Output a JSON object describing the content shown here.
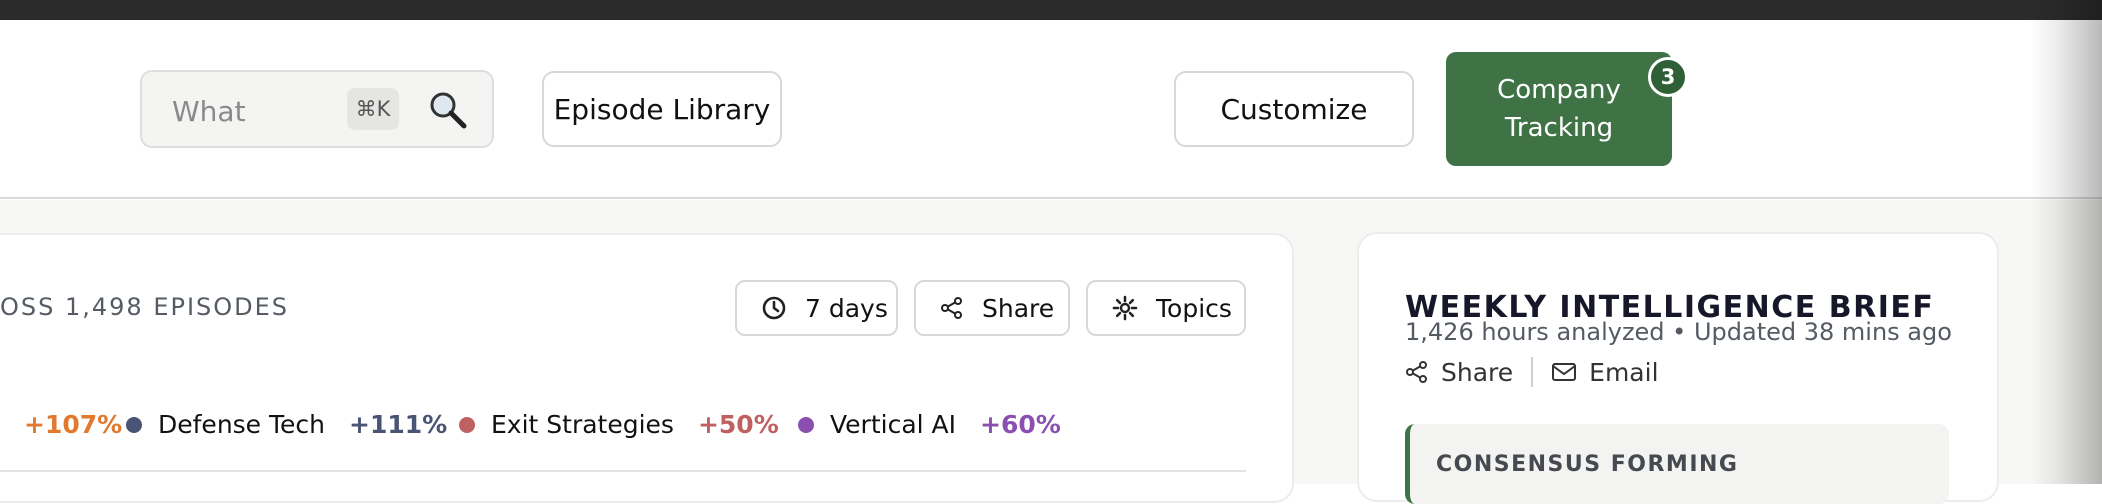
{
  "header": {
    "search": {
      "placeholder": "What",
      "shortcut": "⌘K"
    },
    "episode_library_label": "Episode Library",
    "customize_label": "Customize",
    "company_tracking": {
      "line1": "Company",
      "line2": "Tracking",
      "badge": "3"
    }
  },
  "main": {
    "section_title": "OSS 1,498 EPISODES",
    "controls": {
      "range_label": "7 days",
      "share_label": "Share",
      "topics_label": "Topics"
    },
    "legend": [
      {
        "name": "",
        "pct": "+107%",
        "color": "#e07a2e"
      },
      {
        "name": "Defense Tech",
        "pct": "+111%",
        "color": "#4a5575"
      },
      {
        "name": "Exit Strategies",
        "pct": "+50%",
        "color": "#c06060"
      },
      {
        "name": "Vertical AI",
        "pct": "+60%",
        "color": "#8a4fb0"
      }
    ]
  },
  "brief": {
    "title": "WEEKLY INTELLIGENCE BRIEF",
    "subtitle": "1,426 hours analyzed • Updated 38 mins ago",
    "share_label": "Share",
    "email_label": "Email",
    "consensus_label": "CONSENSUS FORMING"
  },
  "colors": {
    "accent": "#3f7346",
    "badge": "#2f5f36"
  }
}
